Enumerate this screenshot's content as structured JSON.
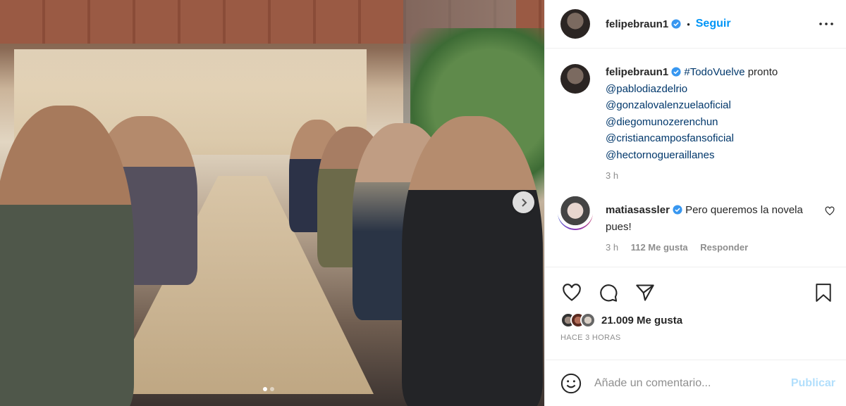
{
  "post": {
    "username": "felipebraun1",
    "separator": "•",
    "follow_label": "Seguir",
    "caption": {
      "hashtag": "#TodoVuelve",
      "text": " pronto",
      "mentions": [
        "@pablodiazdelrio",
        "@gonzalovalenzuelaoficial",
        "@diegomunozerenchun",
        "@cristiancamposfansoficial",
        "@hectornogueraillanes"
      ],
      "time": "3 h"
    },
    "comment": {
      "username": "matiasassler",
      "text": "Pero queremos la novela pues!",
      "time": "3 h",
      "likes": "112 Me gusta",
      "reply_label": "Responder"
    },
    "likes_text": "21.009 Me gusta",
    "posted_ago": "HACE 3 HORAS",
    "add_comment": {
      "placeholder": "Añade un comentario...",
      "publish_label": "Publicar"
    }
  },
  "carousel": {
    "current": 1,
    "total": 2
  },
  "colors": {
    "link": "#0095f6",
    "tag": "#00376b",
    "muted": "#8e8e8e",
    "publish_disabled": "#b2dffc"
  }
}
